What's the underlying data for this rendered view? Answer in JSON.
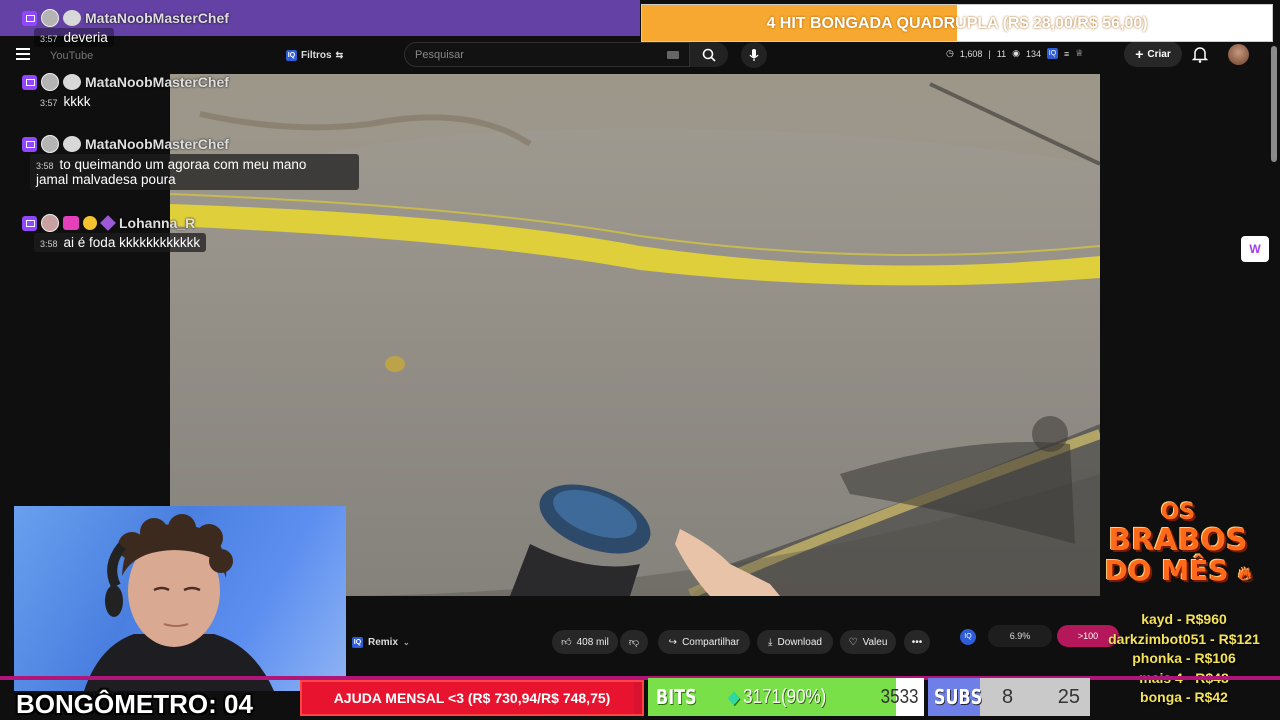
{
  "topbar": {
    "search_placeholder": "Pesquisar",
    "filters_label": "Filtros",
    "filters_badge": "IQ",
    "stats": [
      "1,608",
      "11",
      "134"
    ],
    "create_label": "Criar",
    "yt_logo_text": "YouTube"
  },
  "goal_top": {
    "text": "4 HIT BONGADA QUADRUPLA (R$ 28,00/R$ 56,00)",
    "progress": 0.5
  },
  "chat": [
    {
      "user": "MataNoobMasterChef",
      "time": "3:57",
      "text": "deveria"
    },
    {
      "user": "MataNoobMasterChef",
      "time": "3:57",
      "text": "kkkk"
    },
    {
      "user": "MataNoobMasterChef",
      "time": "3:58",
      "text": "to queimando um agoraa com meu mano",
      "text2": "jamal malvadesa poura"
    },
    {
      "user": "Lohanna_R",
      "time": "3:58",
      "text": "ai é foda kkkkkkkkkkkk"
    }
  ],
  "video_actions": {
    "remix": "Remix",
    "likes": "408 mil",
    "share": "Compartilhar",
    "download": "Download",
    "thanks": "Valeu",
    "iq_a": "6.9%",
    "iq_b": ">100"
  },
  "brabos": {
    "title_l1": "OS",
    "title_l2": "BRABOS",
    "title_l3": "DO MÊS",
    "leaders": [
      "kayd - R$960",
      "darkzimbot051 - R$121",
      "phonka - R$106",
      "mais 4 - R$48",
      "bonga - R$42"
    ]
  },
  "bongometro": {
    "label": "BONGÔMETRO: 04"
  },
  "ajuda": {
    "text": "AJUDA MENSAL <3 (R$ 730,94/R$ 748,75)",
    "progress": 0.976
  },
  "bits": {
    "label": "BITS",
    "value": "3171(90%)",
    "max": "3533",
    "progress": 0.9
  },
  "subs": {
    "label": "SUBS",
    "value": "8",
    "max": "25",
    "progress": 0.32
  },
  "colors": {
    "twitch": "#9146ff",
    "goal_orange": "#f7a830",
    "ajuda_red": "#d9122f",
    "bits_green": "#7ae04a",
    "subs_blue": "#6f7fe8",
    "leader_yellow": "#f3e25a"
  }
}
